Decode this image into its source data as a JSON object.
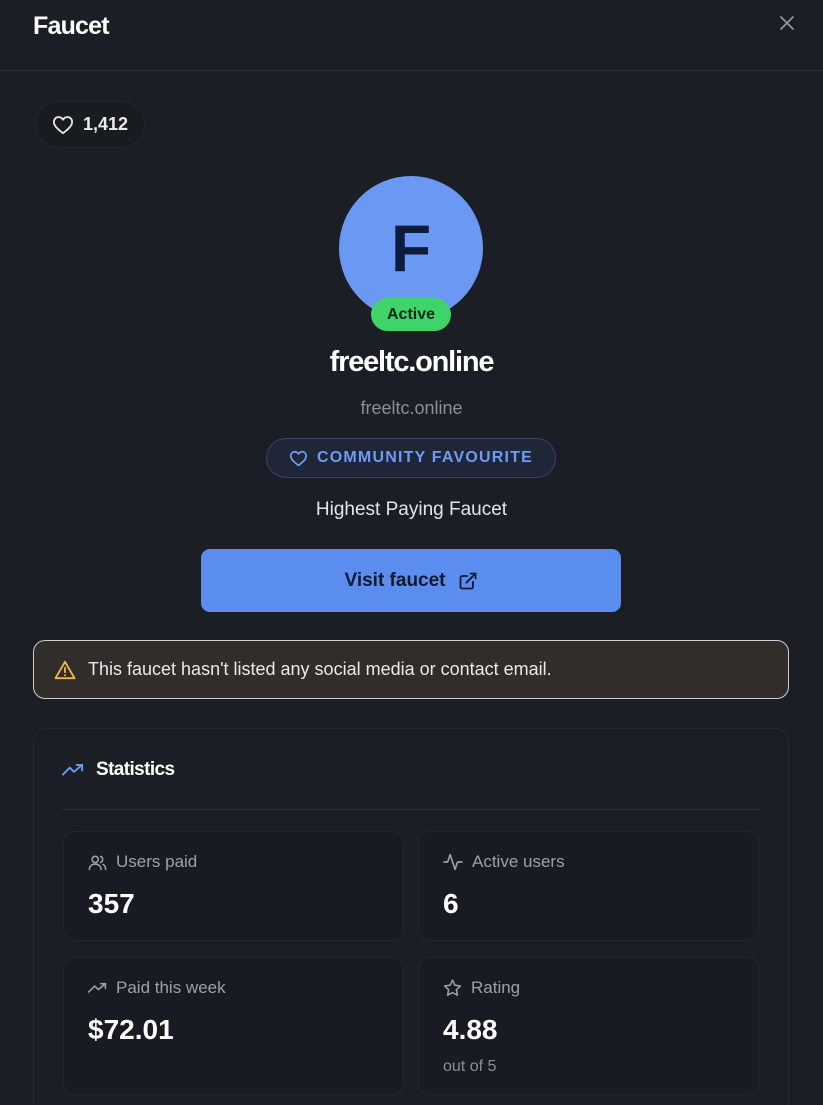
{
  "header": {
    "title": "Faucet",
    "close_icon": "close-icon"
  },
  "likes": {
    "icon": "heart-icon",
    "count": "1,412"
  },
  "faucet": {
    "avatar_letter": "F",
    "avatar_color": "#6a98f3",
    "status": "Active",
    "status_color": "#3fd46a",
    "name": "freeltc.online",
    "domain": "freeltc.online",
    "badge": {
      "icon": "heart-icon",
      "label": "COMMUNITY FAVOURITE"
    },
    "tagline": "Highest Paying Faucet"
  },
  "visit_button": {
    "label": "Visit faucet",
    "icon": "external-link-icon",
    "color": "#5b8def"
  },
  "warning": {
    "icon": "warning-triangle-icon",
    "text": "This faucet hasn't listed any social media or contact email."
  },
  "statistics": {
    "title": "Statistics",
    "icon": "trending-up-icon",
    "items": [
      {
        "label": "Users paid",
        "icon": "users-icon",
        "value": "357"
      },
      {
        "label": "Active users",
        "icon": "activity-icon",
        "value": "6"
      },
      {
        "label": "Paid this week",
        "icon": "trending-up-icon",
        "value": "$72.01"
      },
      {
        "label": "Rating",
        "icon": "star-icon",
        "value": "4.88",
        "sub": "out of 5"
      }
    ]
  }
}
